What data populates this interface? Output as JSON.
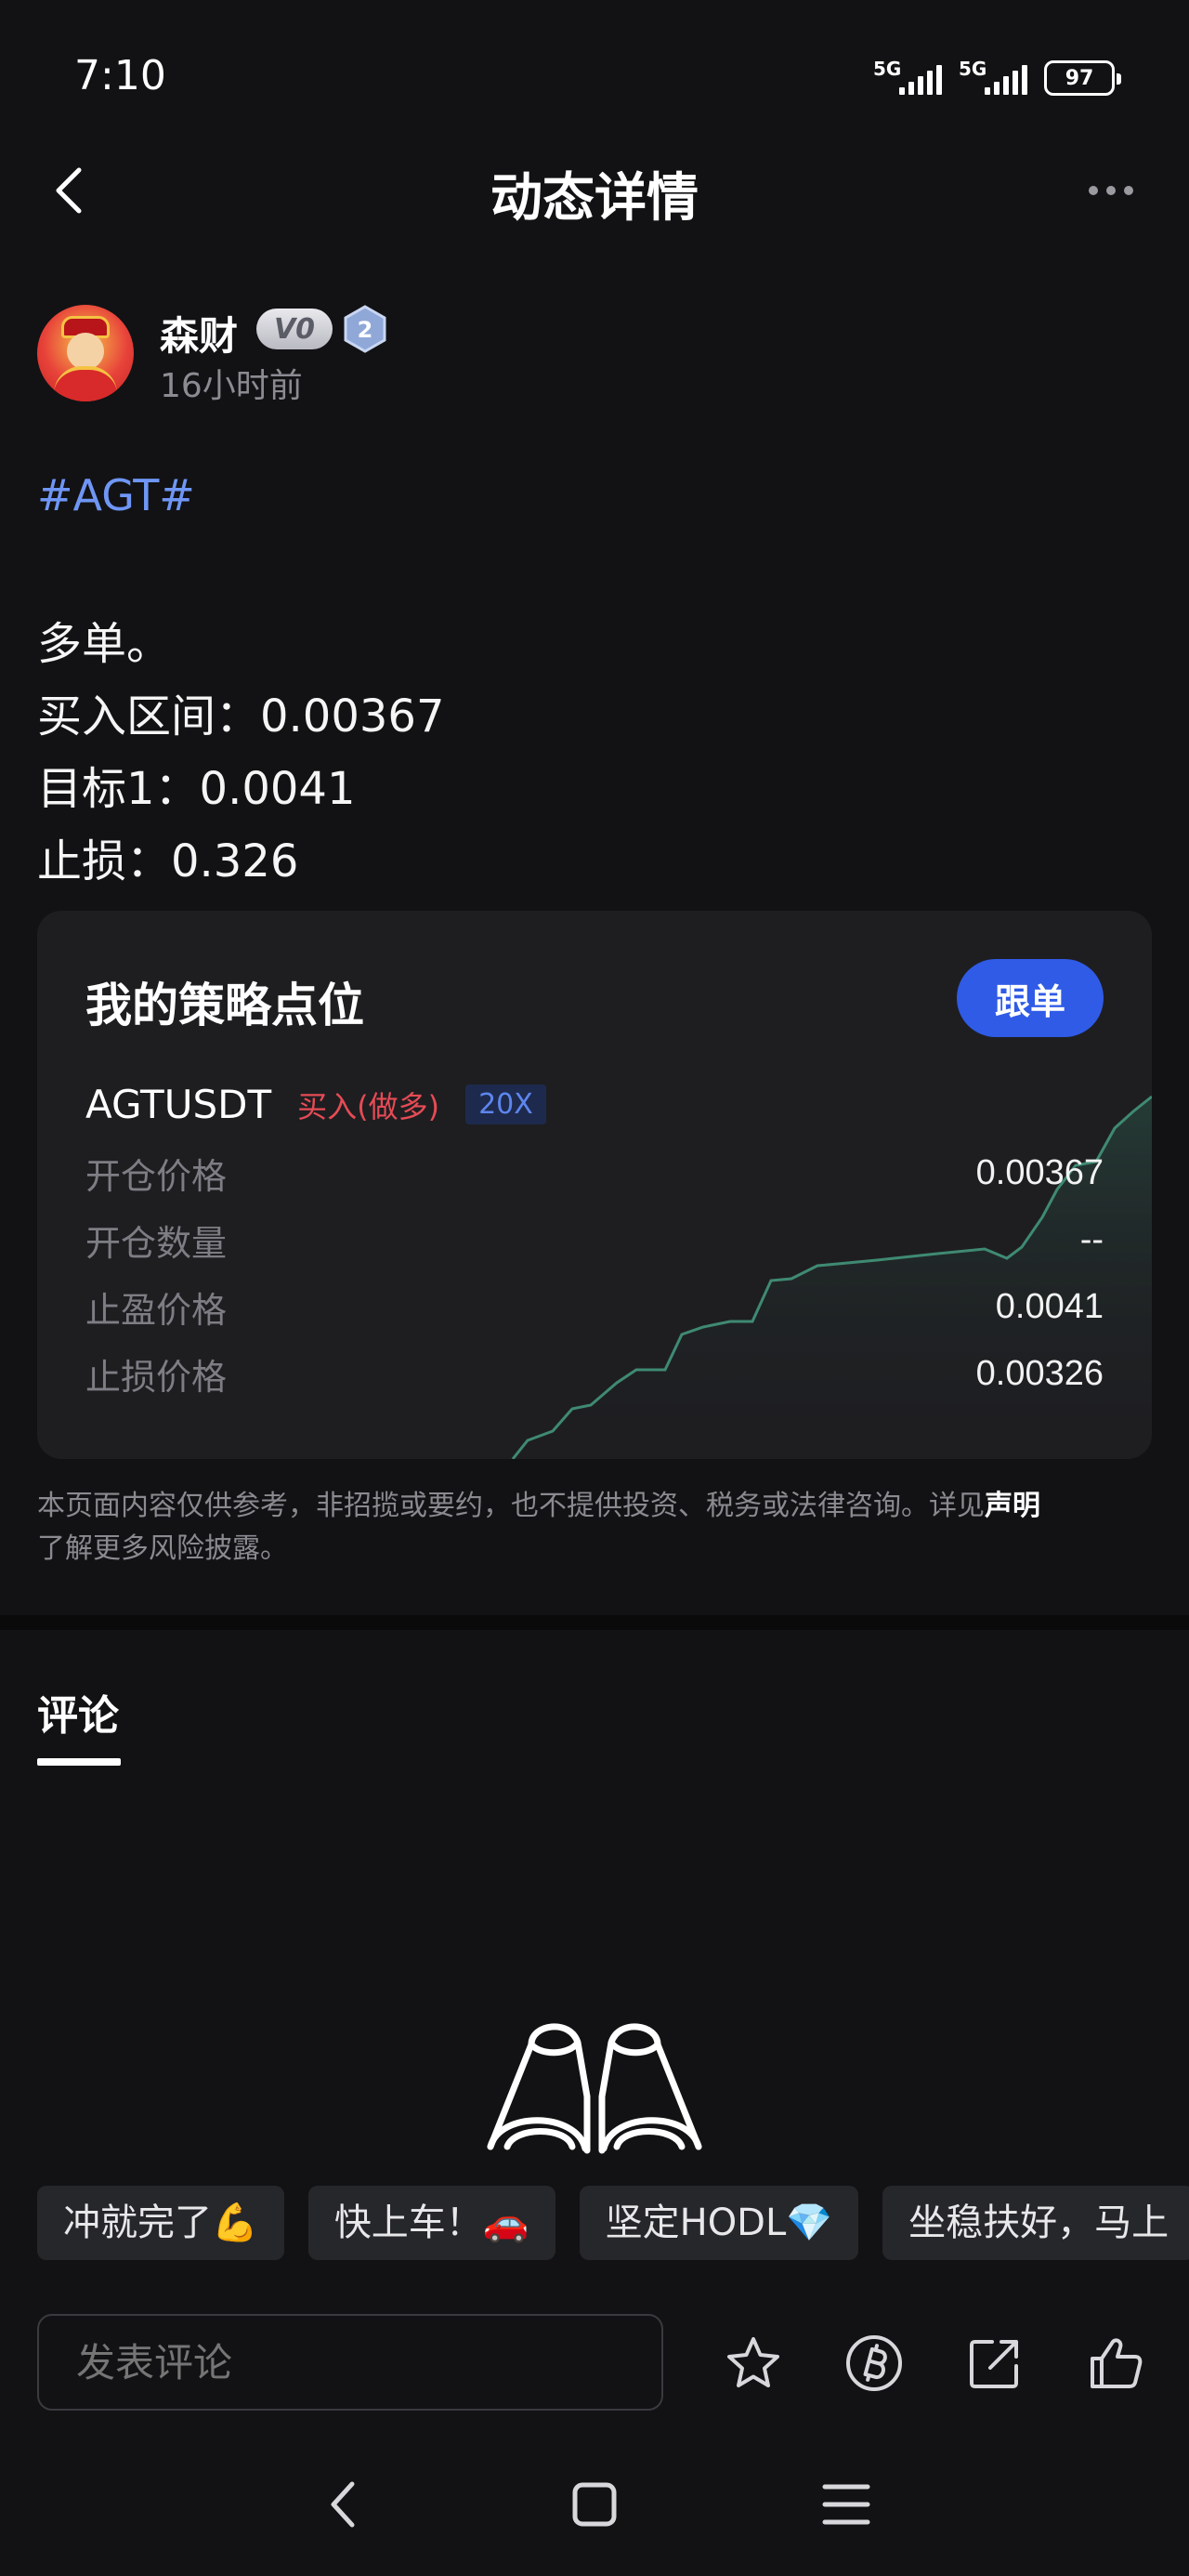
{
  "status_bar": {
    "time": "7:10",
    "signal1_label": "5G",
    "signal2_label": "5G",
    "battery": "97"
  },
  "header": {
    "title": "动态详情",
    "back_icon": "chevron-left-icon",
    "more_icon": "more-dots-icon"
  },
  "author": {
    "name": "森财",
    "vip_level": "V0",
    "rank_badge": "2",
    "time_ago": "16小时前"
  },
  "post": {
    "tag": "#AGT#",
    "lines": [
      "多单。",
      "买入区间：0.00367",
      "目标1：0.0041",
      "止损：0.326"
    ]
  },
  "strategy_card": {
    "title": "我的策略点位",
    "follow_label": "跟单",
    "symbol": "AGTUSDT",
    "side": "买入(做多)",
    "leverage": "20X",
    "rows": [
      {
        "label": "开仓价格",
        "value": "0.00367"
      },
      {
        "label": "开仓数量",
        "value": "--"
      },
      {
        "label": "止盈价格",
        "value": "0.0041"
      },
      {
        "label": "止损价格",
        "value": "0.00326"
      }
    ],
    "accent_color": "#2f5be6",
    "chart_line_color": "#3f8a72"
  },
  "disclaimer": {
    "text": "本页面内容仅供参考，非招揽或要约，也不提供投资、税务或法律咨询。详见",
    "link": "声明",
    "tail": "了解更多风险披露。"
  },
  "comments": {
    "tab_label": "评论",
    "empty_icon": "binoculars-icon"
  },
  "quick_replies": [
    "冲就完了💪",
    "快上车！🚗",
    "坚定HODL💎",
    "坐稳扶好，马上"
  ],
  "bottom_bar": {
    "comment_placeholder": "发表评论",
    "icons": [
      "star-icon",
      "tip-coin-icon",
      "share-icon",
      "like-icon"
    ]
  },
  "nav_bar": {
    "icons": [
      "nav-back-icon",
      "nav-home-icon",
      "nav-menu-icon"
    ]
  }
}
